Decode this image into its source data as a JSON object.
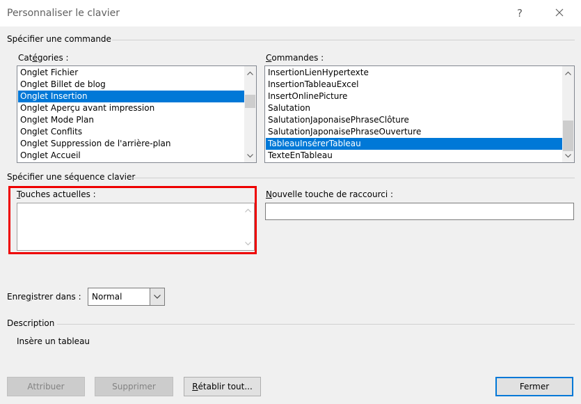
{
  "window": {
    "title": "Personnaliser le clavier",
    "help_label": "?"
  },
  "command_section": {
    "title": "Spécifier une commande",
    "categories_label_pre": "Cat",
    "categories_label_key": "é",
    "categories_label_post": "gories :",
    "commands_label_key": "C",
    "commands_label_post": "ommandes :",
    "categories": [
      {
        "label": "Onglet Fichier"
      },
      {
        "label": "Onglet Billet de blog"
      },
      {
        "label": "Onglet Insertion"
      },
      {
        "label": "Onglet Aperçu avant impression"
      },
      {
        "label": "Onglet Mode Plan"
      },
      {
        "label": "Onglet Conflits"
      },
      {
        "label": "Onglet Suppression de l'arrière-plan"
      },
      {
        "label": "Onglet Accueil"
      }
    ],
    "categories_selected": "Onglet Insertion",
    "commands": [
      {
        "label": "InsertionLienHypertexte"
      },
      {
        "label": "InsertionTableauExcel"
      },
      {
        "label": "InsertOnlinePicture"
      },
      {
        "label": "Salutation"
      },
      {
        "label": "SalutationJaponaisePhraseClôture"
      },
      {
        "label": "SalutationJaponaisePhraseOuverture"
      },
      {
        "label": "TableauInsérerTableau"
      },
      {
        "label": "TexteEnTableau"
      }
    ],
    "commands_selected": "TableauInsérerTableau",
    "categories_scroll": {
      "thumb_start": 0.22,
      "thumb_size": 0.18
    },
    "commands_scroll": {
      "thumb_start": 0.58,
      "thumb_size": 0.42
    }
  },
  "key_section": {
    "title": "Spécifier une séquence clavier",
    "current_keys_label_key": "T",
    "current_keys_label_post": "ouches actuelles :",
    "current_keys": "",
    "new_key_label_key": "N",
    "new_key_label_post": "ouvelle touche de raccourci :",
    "new_key_value": ""
  },
  "save_in": {
    "label_pre": "Enre",
    "label_key": "g",
    "label_post": "istrer dans :",
    "value": "Normal"
  },
  "description": {
    "title": "Description",
    "text": "Insère un tableau"
  },
  "buttons": {
    "assign": "Attribuer",
    "remove": "Supprimer",
    "reset_key": "R",
    "reset_post": "établir tout...",
    "close": "Fermer"
  },
  "colors": {
    "selection": "#0078d7",
    "highlight": "#ee0000",
    "default_button_border": "#0078d7"
  },
  "icons": {
    "close": "close-icon",
    "scroll_up": "chevron-up-icon",
    "scroll_down": "chevron-down-icon",
    "dropdown": "chevron-down-icon"
  }
}
